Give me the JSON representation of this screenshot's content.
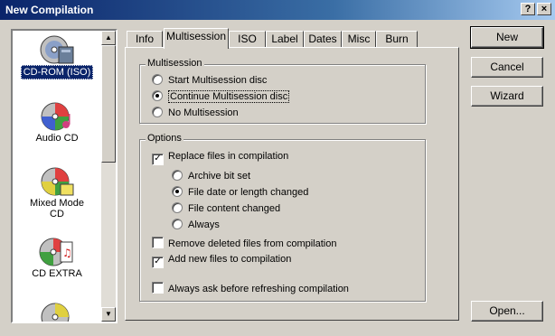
{
  "window": {
    "title": "New Compilation",
    "help_label": "?",
    "close_label": "×"
  },
  "types": [
    {
      "label": "CD-ROM (ISO)",
      "icon": "cd-rom-iso-icon",
      "selected": true
    },
    {
      "label": "Audio CD",
      "icon": "audio-cd-icon"
    },
    {
      "label": "Mixed Mode CD",
      "icon": "mixed-mode-cd-icon"
    },
    {
      "label": "CD EXTRA",
      "icon": "cd-extra-icon"
    }
  ],
  "tabs": [
    {
      "label": "Info"
    },
    {
      "label": "Multisession",
      "active": true
    },
    {
      "label": "ISO"
    },
    {
      "label": "Label"
    },
    {
      "label": "Dates"
    },
    {
      "label": "Misc"
    },
    {
      "label": "Burn"
    }
  ],
  "multisession": {
    "group_label": "Multisession",
    "options": [
      {
        "label": "Start Multisession disc",
        "selected": false
      },
      {
        "label": "Continue Multisession disc",
        "selected": true
      },
      {
        "label": "No Multisession",
        "selected": false
      }
    ]
  },
  "options": {
    "group_label": "Options",
    "replace_files": {
      "label": "Replace files in compilation",
      "checked": true
    },
    "replace_mode": [
      {
        "label": "Archive bit set",
        "selected": false
      },
      {
        "label": "File date or length changed",
        "selected": true
      },
      {
        "label": "File content changed",
        "selected": false
      },
      {
        "label": "Always",
        "selected": false
      }
    ],
    "remove_deleted": {
      "label": "Remove deleted files from compilation",
      "checked": false
    },
    "add_new": {
      "label": "Add new files to compilation",
      "checked": true
    },
    "always_ask": {
      "label": "Always ask before refreshing compilation",
      "checked": false
    }
  },
  "buttons": {
    "new": "New",
    "cancel": "Cancel",
    "wizard": "Wizard",
    "open": "Open..."
  }
}
